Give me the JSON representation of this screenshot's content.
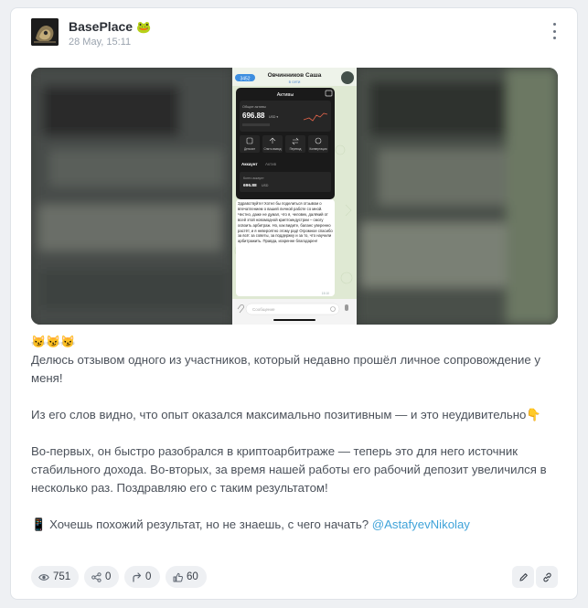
{
  "post": {
    "author": "BasePlace",
    "author_badge": "🐸",
    "date": "28 May, 15:11"
  },
  "media": {
    "phone": {
      "back_badge": "3452",
      "contact_name": "Овчинников Саша",
      "contact_status": "в сети",
      "app_title": "Активы",
      "balance_label": "Общие активы",
      "balance_value": "696.88",
      "balance_currency": "USD ▾",
      "actions": [
        "Депозит",
        "Снять вывод",
        "Перевод",
        "Конвертация"
      ],
      "tabs": [
        "Аккаунт",
        "Актив"
      ],
      "account_label": "Конто аккаунт",
      "account_value": "696.88",
      "account_currency": "USD",
      "message": "Здравствуйте! Хотел бы поделиться отзывом о впечатлением о вашей личной работе со мной. Честно, даже не думал, что я, человек, далёкий от всей этой новомодной криптоиндустрии – смогу освоить арбитраж. Но, как видите, баланс уверенно растёт, и я невероятно этому рад! Огромное спасибо за всё: за советы, за поддержку и за то, что научили арбитражить. Правда, искренне благодарен!",
      "message_time": "15:10",
      "input_placeholder": "Сообщение"
    }
  },
  "text": {
    "emojis": "😼😼😼",
    "p1": "Делюсь отзывом одного из участников, который недавно прошёл личное сопровождение у меня!",
    "p2": "Из его слов видно, что опыт оказался максимально позитивным — и это неудивительно",
    "p2_emoji": "👇",
    "p3": "Во-первых, он быстро разобрался в криптоарбитраже — теперь это для него источник стабильного дохода. Во-вторых, за время нашей работы его рабочий депозит увеличился в несколько раз. Поздравляю его с таким результатом!",
    "p4_emoji": "📱",
    "p4": " Хочешь похожий результат, но не знаешь, с чего начать? ",
    "mention": "@AstafyevNikolay"
  },
  "stats": {
    "views": "751",
    "shares": "0",
    "reposts": "0",
    "likes": "60"
  },
  "icons": {
    "more": "kebab-icon",
    "views": "eye-icon",
    "shares": "share-icon",
    "reposts": "repost-icon",
    "likes": "thumbs-up-icon",
    "edit": "pencil-icon",
    "link": "link-icon"
  },
  "colors": {
    "mention": "#3fa3d9",
    "text": "#4b515a",
    "pill_bg": "#eef0f3"
  }
}
